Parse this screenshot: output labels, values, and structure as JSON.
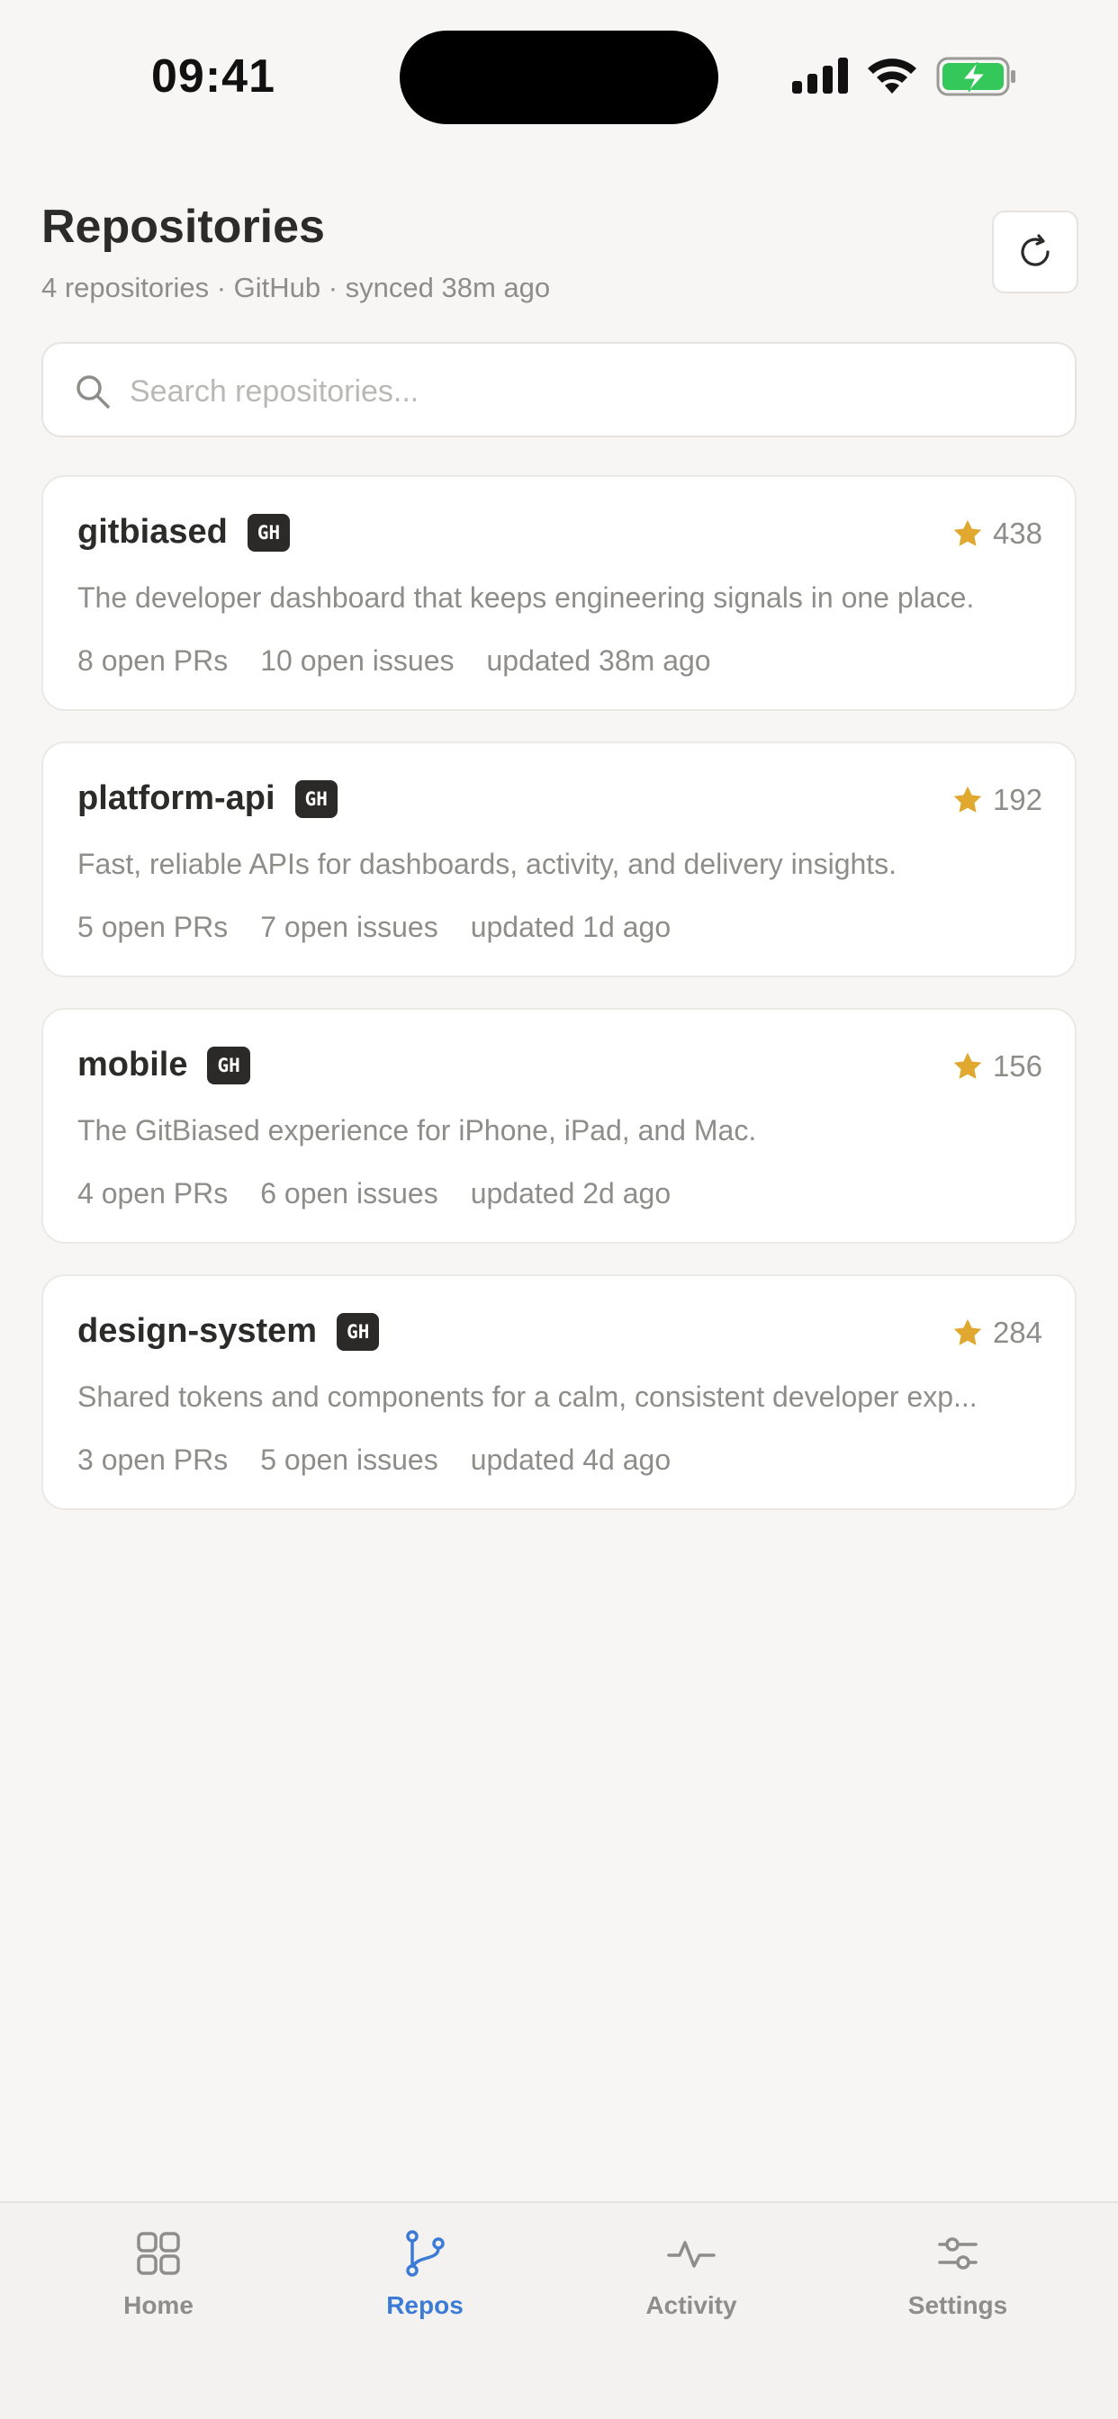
{
  "status_bar": {
    "time": "09:41"
  },
  "header": {
    "title": "Repositories",
    "subtitle": "4 repositories · GitHub · synced 38m ago"
  },
  "search": {
    "placeholder": "Search repositories..."
  },
  "repos": [
    {
      "name": "gitbiased",
      "badge": "GH",
      "stars": "438",
      "description": "The developer dashboard that keeps engineering signals in one place.",
      "prs": "8 open PRs",
      "issues": "10 open issues",
      "updated": "updated 38m ago"
    },
    {
      "name": "platform-api",
      "badge": "GH",
      "stars": "192",
      "description": "Fast, reliable APIs for dashboards, activity, and delivery insights.",
      "prs": "5 open PRs",
      "issues": "7 open issues",
      "updated": "updated 1d ago"
    },
    {
      "name": "mobile",
      "badge": "GH",
      "stars": "156",
      "description": "The GitBiased experience for iPhone, iPad, and Mac.",
      "prs": "4 open PRs",
      "issues": "6 open issues",
      "updated": "updated 2d ago"
    },
    {
      "name": "design-system",
      "badge": "GH",
      "stars": "284",
      "description": "Shared tokens and components for a calm, consistent developer exp...",
      "prs": "3 open PRs",
      "issues": "5 open issues",
      "updated": "updated 4d ago"
    }
  ],
  "tabs": [
    {
      "label": "Home",
      "icon": "grid-icon",
      "active": false
    },
    {
      "label": "Repos",
      "icon": "branch-icon",
      "active": true
    },
    {
      "label": "Activity",
      "icon": "pulse-icon",
      "active": false
    },
    {
      "label": "Settings",
      "icon": "sliders-icon",
      "active": false
    }
  ],
  "colors": {
    "background": "#f7f6f4",
    "accent": "#3b7bd6",
    "star": "#e0a82e",
    "battery": "#34c759"
  }
}
